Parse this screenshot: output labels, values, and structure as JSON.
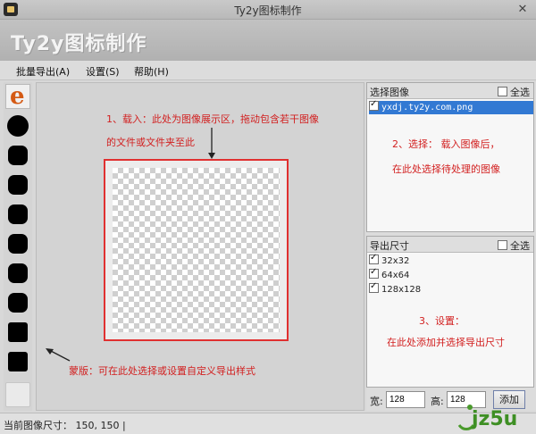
{
  "window": {
    "title": "Ty2y图标制作",
    "close_glyph": "✕"
  },
  "banner": {
    "title": "Ty2y图标制作"
  },
  "menu": [
    "批量导出(A)",
    "设置(S)",
    "帮助(H)"
  ],
  "masks": [
    {
      "shape": "logo",
      "glyph": "e"
    },
    {
      "shape": "circle"
    },
    {
      "shape": "round"
    },
    {
      "shape": "round"
    },
    {
      "shape": "round"
    },
    {
      "shape": "round"
    },
    {
      "shape": "round"
    },
    {
      "shape": "round"
    },
    {
      "shape": "square"
    },
    {
      "shape": "square"
    },
    {
      "shape": "empty"
    }
  ],
  "annotations": {
    "load_line1": "1、载入：此处为图像展示区，拖动包含若干图像",
    "load_line2": "的文件或文件夹至此",
    "select_line1": "2、选择：   载入图像后，",
    "select_line2": "在此处选择待处理的图像",
    "settings_line1": "3、设置：",
    "settings_line2": "在此处添加并选择导出尺寸",
    "mask_note": "蒙版：可在此处选择或设置自定义导出样式"
  },
  "image_list": {
    "title": "选择图像",
    "select_all": "全选",
    "items": [
      {
        "name": "yxdj.ty2y.com.png",
        "checked": true,
        "selected": true
      }
    ]
  },
  "export_sizes": {
    "title": "导出尺寸",
    "select_all": "全选",
    "items": [
      {
        "label": "32x32",
        "checked": true
      },
      {
        "label": "64x64",
        "checked": true
      },
      {
        "label": "128x128",
        "checked": true
      }
    ]
  },
  "size_form": {
    "width_label": "宽:",
    "width_value": "128",
    "height_label": "高:",
    "height_value": "128",
    "add_label": "添加"
  },
  "status": {
    "text": "当前图像尺寸：  150, 150  |"
  },
  "watermark": {
    "text": "jz5u"
  },
  "colors": {
    "annotation": "#d21f1f",
    "selection": "#3279d3",
    "logo": "#d45a14",
    "watermark": "#4a9a2c"
  }
}
